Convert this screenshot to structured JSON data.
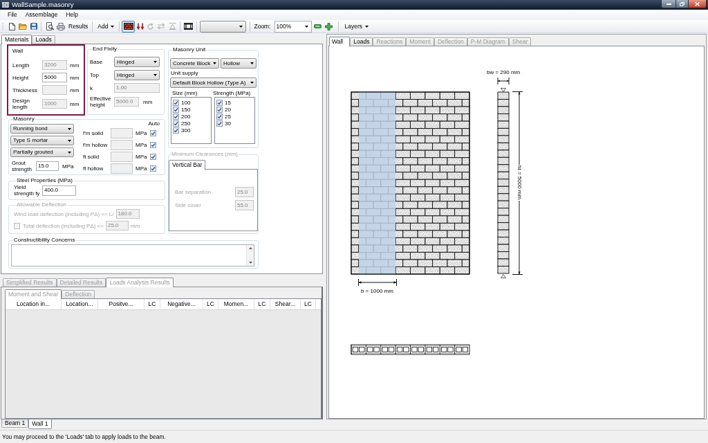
{
  "window": {
    "title": "WallSample.masonry"
  },
  "menu": [
    "File",
    "Assemblage",
    "Help"
  ],
  "toolbar": {
    "results_label": "Results",
    "add_label": "Add",
    "view_buttons": [
      {
        "selected": true,
        "disabled": false
      },
      {
        "selected": false,
        "disabled": false
      },
      {
        "selected": false,
        "disabled": true
      },
      {
        "selected": false,
        "disabled": true
      },
      {
        "selected": false,
        "disabled": true
      }
    ],
    "zoom_label": "Zoom:",
    "zoom_value": "100%",
    "layers_label": "Layers"
  },
  "left_tabs": [
    {
      "label": "Materials",
      "selected": true
    },
    {
      "label": "Loads",
      "selected": false
    }
  ],
  "wall": {
    "title": "Wall",
    "highlighted": true,
    "fields": [
      {
        "label": "Length",
        "value": "3200",
        "unit": "mm",
        "disabled": true
      },
      {
        "label": "Height",
        "value": "5000",
        "unit": "mm",
        "disabled": false
      },
      {
        "label": "Thickness",
        "unit": "mm",
        "disabled": true
      },
      {
        "label": "Design length",
        "value": "1000",
        "unit": "mm",
        "disabled": true
      }
    ]
  },
  "end_fixity": {
    "title": "End Fixity",
    "fields": [
      {
        "kind": "select",
        "label": "Base",
        "value": "Hinged",
        "disabled": false
      },
      {
        "kind": "select",
        "label": "Top",
        "value": "Hinged",
        "disabled": false
      },
      {
        "kind": "input",
        "label": "k",
        "value": "1.00",
        "disabled": true
      },
      {
        "kind": "input",
        "label": "Effective height",
        "value": "5000.0",
        "unit": "mm",
        "disabled": true
      }
    ]
  },
  "masonry_unit": {
    "title": "Masonry Unit",
    "unit_type": "Concrete Block",
    "unit_form": "Hollow",
    "unit_supply_label": "Unit supply",
    "unit_supply": "Default Block Hollow (Type A)",
    "size_list": {
      "title": "Size (mm)",
      "items": [
        {
          "label": "100",
          "checked": true
        },
        {
          "label": "150",
          "checked": true
        },
        {
          "label": "200",
          "checked": true
        },
        {
          "label": "250",
          "checked": true
        },
        {
          "label": "300",
          "checked": true
        }
      ]
    },
    "strength_list": {
      "title": "Strength (MPa)",
      "items": [
        {
          "label": "15",
          "checked": true
        },
        {
          "label": "20",
          "checked": true
        },
        {
          "label": "25",
          "checked": true
        },
        {
          "label": "30",
          "checked": true
        }
      ]
    }
  },
  "masonry": {
    "title": "Masonry",
    "selects": [
      "Running bond",
      "Type S mortar",
      "Partially grouted"
    ],
    "grout": {
      "label": "Grout strength",
      "value": "15.0",
      "unit": "MPa"
    },
    "auto_label": "Auto",
    "properties": [
      {
        "label": "f'm solid",
        "unit": "MPa",
        "auto": true
      },
      {
        "label": "f'm hollow",
        "unit": "MPa",
        "auto": true
      },
      {
        "label": "ft solid",
        "unit": "MPa",
        "auto": true
      },
      {
        "label": "ft hollow",
        "unit": "MPa",
        "auto": true
      }
    ]
  },
  "steel": {
    "title": "Steel Properties (MPa)",
    "label": "Yield strength fy",
    "value": "400.0"
  },
  "allowable_deflection": {
    "title": "Allowable Deflection",
    "disabled": true,
    "wind": {
      "label": "Wind load deflection (including PΔ) <= L/",
      "value": "180.0"
    },
    "total": {
      "label": "Total deflection (including PΔ) <=",
      "value": "25.0",
      "unit": "mm",
      "checked": false
    }
  },
  "minimum_clearances": {
    "title": "Minimum Clearances (mm)",
    "disabled": true,
    "tabs": [
      {
        "label": "Vertical Bar",
        "selected": true
      }
    ],
    "fields": [
      {
        "label": "Bar separation",
        "value": "25.0"
      },
      {
        "label": "Side cover",
        "value": "55.0"
      }
    ]
  },
  "constructibility": {
    "title": "Constructibility Concerns"
  },
  "results": {
    "disabled": true,
    "tabs": [
      {
        "label": "Simplified Results",
        "selected": false
      },
      {
        "label": "Detailed Results",
        "selected": false
      },
      {
        "label": "Loads Analysis Results",
        "selected": true
      }
    ],
    "subtabs": [
      {
        "label": "Moment and Shear",
        "selected": true
      },
      {
        "label": "Deflection",
        "selected": false
      }
    ],
    "columns": [
      "Location in...",
      "Location...",
      "Positve...",
      "LC",
      "Negative...",
      "LC",
      "Momen...",
      "LC",
      "Shear...",
      "LC"
    ]
  },
  "view_tabs": [
    {
      "label": "Wall",
      "selected": true,
      "disabled": false
    },
    {
      "label": "Loads",
      "selected": false,
      "disabled": false
    },
    {
      "label": "Reactions",
      "selected": false,
      "disabled": true
    },
    {
      "label": "Moment",
      "selected": false,
      "disabled": true
    },
    {
      "label": "Deflection",
      "selected": false,
      "disabled": true
    },
    {
      "label": "P-M Diagram",
      "selected": false,
      "disabled": true
    },
    {
      "label": "Shear",
      "selected": false,
      "disabled": true
    }
  ],
  "drawing": {
    "width_label": "b = 1000 mm",
    "thickness_label": "bw = 290 mm",
    "height_label": "ht = 5000 mm"
  },
  "document_tabs": [
    {
      "label": "Beam 1",
      "selected": false
    },
    {
      "label": "Wall 1",
      "selected": true
    }
  ],
  "status_bar": {
    "text": "You may proceed to the 'Loads' tab to apply loads to the beam."
  }
}
